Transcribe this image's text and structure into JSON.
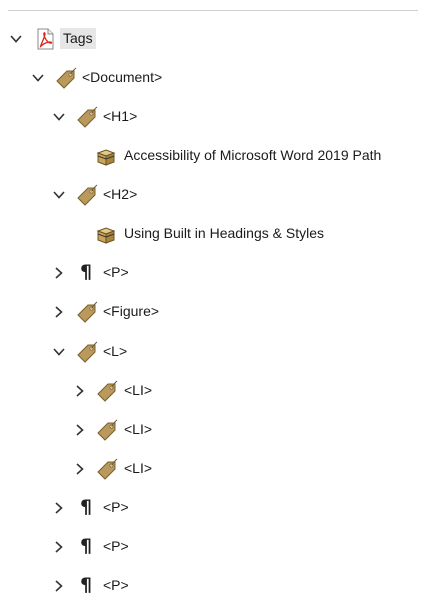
{
  "tree": {
    "root_label": "Tags",
    "nodes": [
      {
        "label": "<Document>",
        "icon": "tag-icon",
        "expanded": true
      },
      {
        "label": "<H1>",
        "icon": "tag-icon",
        "expanded": true
      },
      {
        "label": "Accessibility of Microsoft Word 2019 Path",
        "icon": "content-box-icon"
      },
      {
        "label": "<H2>",
        "icon": "tag-icon",
        "expanded": true
      },
      {
        "label": "Using Built in Headings & Styles",
        "icon": "content-box-icon"
      },
      {
        "label": "<P>",
        "icon": "pilcrow-icon",
        "expanded": false
      },
      {
        "label": "<Figure>",
        "icon": "tag-icon",
        "expanded": false
      },
      {
        "label": "<L>",
        "icon": "tag-icon",
        "expanded": true
      },
      {
        "label": "<LI>",
        "icon": "tag-icon",
        "expanded": false
      },
      {
        "label": "<LI>",
        "icon": "tag-icon",
        "expanded": false
      },
      {
        "label": "<LI>",
        "icon": "tag-icon",
        "expanded": false
      },
      {
        "label": "<P>",
        "icon": "pilcrow-icon",
        "expanded": false
      },
      {
        "label": "<P>",
        "icon": "pilcrow-icon",
        "expanded": false
      },
      {
        "label": "<P>",
        "icon": "pilcrow-icon",
        "expanded": false
      }
    ],
    "pilcrow_glyph": "¶"
  },
  "colors": {
    "tag": "#b99a5c",
    "pdf_red": "#d9261c",
    "selection_bg": "#e6e6e6"
  }
}
